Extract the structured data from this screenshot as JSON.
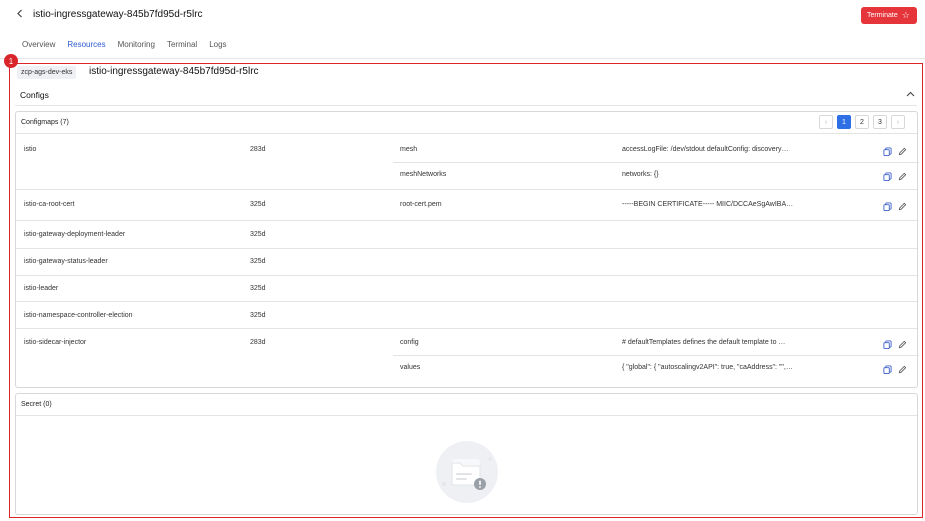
{
  "header": {
    "back_icon": "chevron-left-icon",
    "title": "istio-ingressgateway-845b7fd95d-r5lrc",
    "terminate_label": "Terminate",
    "terminate_icon": "star-icon",
    "accent_color": "#e5353a"
  },
  "tabs": [
    {
      "label": "Overview",
      "active": false
    },
    {
      "label": "Resources",
      "active": true
    },
    {
      "label": "Monitoring",
      "active": false
    },
    {
      "label": "Terminal",
      "active": false
    },
    {
      "label": "Logs",
      "active": false
    }
  ],
  "annotation": {
    "badge": "1",
    "color": "#d9262b"
  },
  "cluster": {
    "chip": "zcp-ags-dev-eks",
    "pod_name": "istio-ingressgateway-845b7fd95d-r5lrc"
  },
  "configs": {
    "title": "Configs",
    "collapse_icon": "chevron-up-icon",
    "configmaps": {
      "title": "Configmaps (7)",
      "pagination": {
        "prev": "‹",
        "pages": [
          "1",
          "2",
          "3"
        ],
        "current": "1",
        "next": "›"
      },
      "rows": [
        {
          "name": "istio",
          "age": "283d",
          "key": "mesh",
          "value": "accessLogFile: /dev/stdout defaultConfig: discovery…"
        },
        {
          "name": "",
          "age": "",
          "key": "meshNetworks",
          "value": "networks: {}"
        },
        {
          "name": "istio-ca-root-cert",
          "age": "325d",
          "key": "root-cert.pem",
          "value": "-----BEGIN CERTIFICATE----- MIIC/DCCAeSgAwIBA…"
        },
        {
          "name": "istio-gateway-deployment-leader",
          "age": "325d",
          "key": "",
          "value": ""
        },
        {
          "name": "istio-gateway-status-leader",
          "age": "325d",
          "key": "",
          "value": ""
        },
        {
          "name": "istio-leader",
          "age": "325d",
          "key": "",
          "value": ""
        },
        {
          "name": "istio-namespace-controller-election",
          "age": "325d",
          "key": "",
          "value": ""
        },
        {
          "name": "istio-sidecar-injector",
          "age": "283d",
          "key": "config",
          "value": "# defaultTemplates defines the default template to …"
        },
        {
          "name": "",
          "age": "",
          "key": "values",
          "value": "{ \"global\": { \"autoscalingv2API\": true, \"caAddress\": \"\",…"
        }
      ]
    },
    "secret": {
      "title": "Secret (0)",
      "empty_icon": "empty-folder-icon"
    }
  }
}
